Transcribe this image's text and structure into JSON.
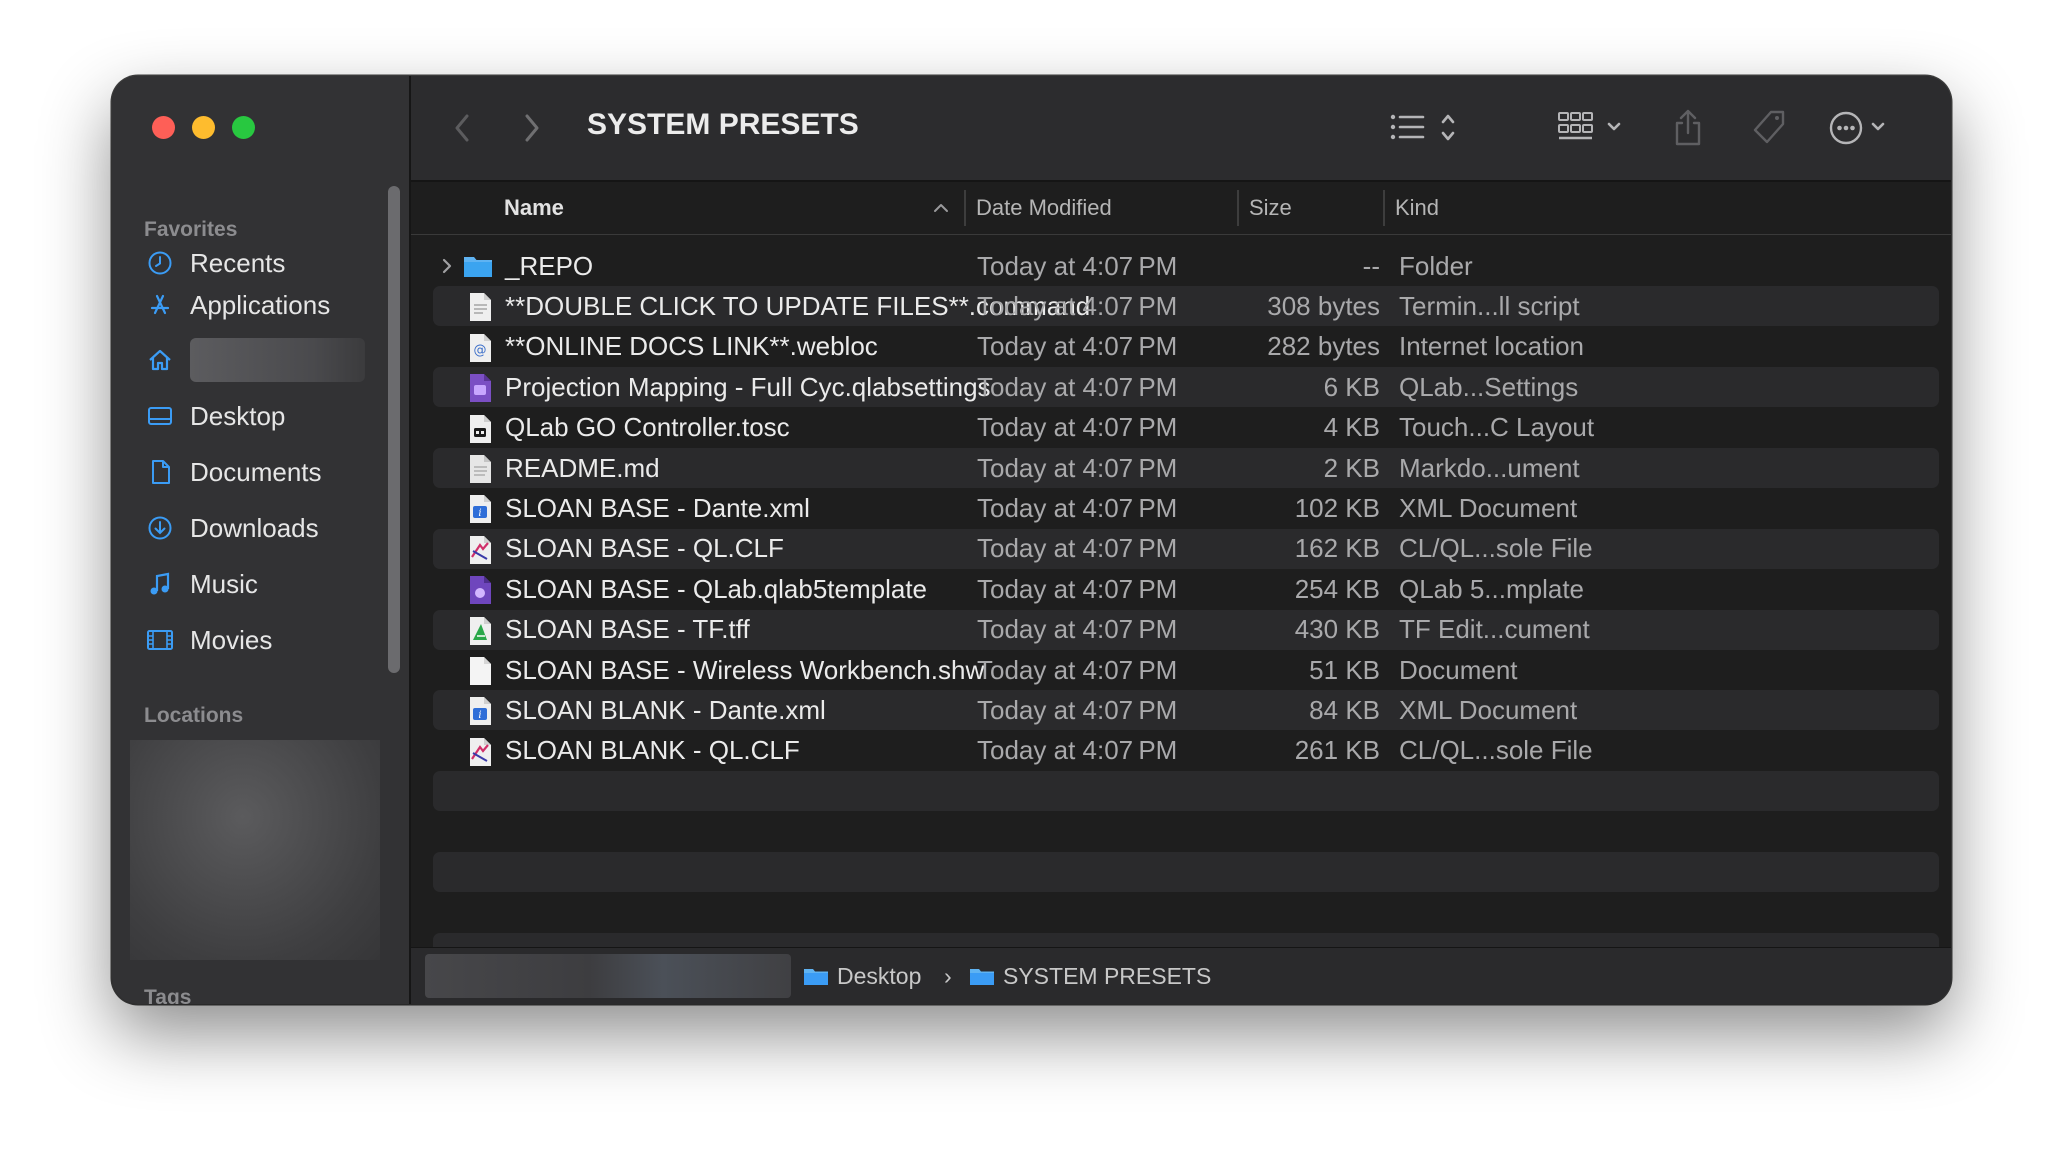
{
  "window": {
    "title": "SYSTEM PRESETS"
  },
  "sidebar": {
    "favorites_heading": "Favorites",
    "items": [
      {
        "label": "Recents",
        "icon": "clock-icon"
      },
      {
        "label": "Applications",
        "icon": "applications-icon"
      },
      {
        "label": "",
        "icon": "home-icon"
      },
      {
        "label": "Desktop",
        "icon": "desktop-icon"
      },
      {
        "label": "Documents",
        "icon": "document-icon"
      },
      {
        "label": "Downloads",
        "icon": "download-icon"
      },
      {
        "label": "Music",
        "icon": "music-icon"
      },
      {
        "label": "Movies",
        "icon": "film-icon"
      }
    ],
    "locations_heading": "Locations",
    "tags_heading": "Tags"
  },
  "columns": {
    "name": "Name",
    "date": "Date Modified",
    "size": "Size",
    "kind": "Kind"
  },
  "files": [
    {
      "name": "_REPO",
      "date": "Today at 4:07 PM",
      "size": "--",
      "kind": "Folder",
      "icon": "folder-icon"
    },
    {
      "name": "**DOUBLE CLICK TO UPDATE FILES**.command",
      "date": "Today at 4:07 PM",
      "size": "308 bytes",
      "kind": "Termin...ll script",
      "icon": "script-file-icon"
    },
    {
      "name": "**ONLINE DOCS LINK**.webloc",
      "date": "Today at 4:07 PM",
      "size": "282 bytes",
      "kind": "Internet location",
      "icon": "webloc-icon"
    },
    {
      "name": "Projection Mapping - Full Cyc.qlabsettings",
      "date": "Today at 4:07 PM",
      "size": "6 KB",
      "kind": "QLab...Settings",
      "icon": "qlab-settings-icon"
    },
    {
      "name": "QLab GO Controller.tosc",
      "date": "Today at 4:07 PM",
      "size": "4 KB",
      "kind": "Touch...C Layout",
      "icon": "touchosc-icon"
    },
    {
      "name": "README.md",
      "date": "Today at 4:07 PM",
      "size": "2 KB",
      "kind": "Markdo...ument",
      "icon": "markdown-file-icon"
    },
    {
      "name": "SLOAN BASE - Dante.xml",
      "date": "Today at 4:07 PM",
      "size": "102 KB",
      "kind": "XML Document",
      "icon": "xml-file-icon"
    },
    {
      "name": "SLOAN BASE - QL.CLF",
      "date": "Today at 4:07 PM",
      "size": "162 KB",
      "kind": "CL/QL...sole File",
      "icon": "clf-file-icon"
    },
    {
      "name": "SLOAN BASE - QLab.qlab5template",
      "date": "Today at 4:07 PM",
      "size": "254 KB",
      "kind": "QLab 5...mplate",
      "icon": "qlab-template-icon"
    },
    {
      "name": "SLOAN BASE - TF.tff",
      "date": "Today at 4:07 PM",
      "size": "430 KB",
      "kind": "TF Edit...cument",
      "icon": "tf-editor-file-icon"
    },
    {
      "name": "SLOAN BASE - Wireless Workbench.shw",
      "date": "Today at 4:07 PM",
      "size": "51 KB",
      "kind": "Document",
      "icon": "blank-document-icon"
    },
    {
      "name": "SLOAN BLANK - Dante.xml",
      "date": "Today at 4:07 PM",
      "size": "84 KB",
      "kind": "XML Document",
      "icon": "xml-file-icon"
    },
    {
      "name": "SLOAN BLANK - QL.CLF",
      "date": "Today at 4:07 PM",
      "size": "261 KB",
      "kind": "CL/QL...sole File",
      "icon": "clf-file-icon"
    }
  ],
  "path_bar": {
    "segments": [
      "Desktop",
      "SYSTEM PRESETS"
    ],
    "separator": "›"
  },
  "colors": {
    "accent": "#3b9cf5",
    "folder": "#5fb3f2",
    "close": "#fe5f57",
    "minimize": "#febc2e",
    "zoom": "#28c840"
  }
}
